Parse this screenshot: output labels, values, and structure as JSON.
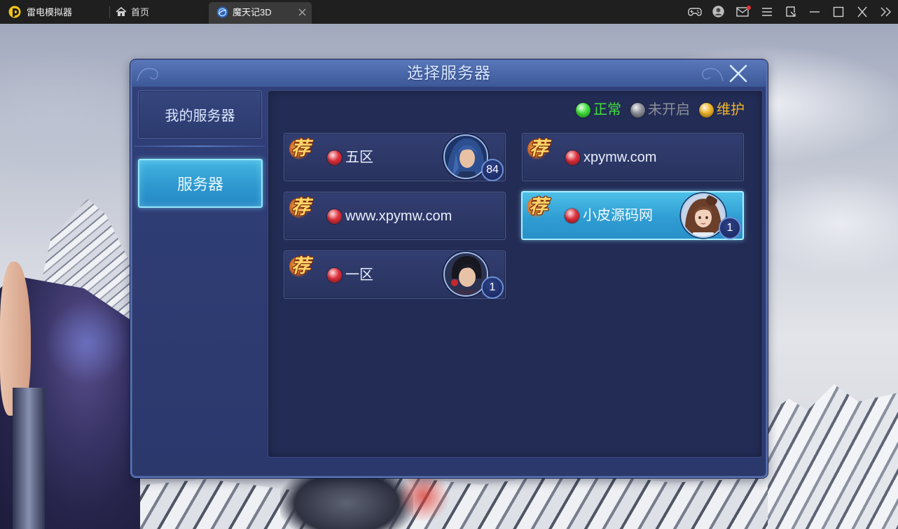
{
  "emulator": {
    "app_name": "雷电模拟器",
    "home_tab": "首页",
    "active_tab": "魔天记3D",
    "icons": [
      "logo-icon",
      "home-icon",
      "game-icon",
      "tab-close-icon",
      "gamepad-icon",
      "user-icon",
      "mail-icon",
      "menu-icon",
      "expand-icon",
      "minimize-icon",
      "maximize-icon",
      "close-icon",
      "more-icon"
    ],
    "notification_dot_color": "#e8302f"
  },
  "dialog": {
    "title": "选择服务器",
    "close_icon": "close-icon",
    "sidebar": [
      {
        "label": "我的服务器",
        "selected": false
      },
      {
        "label": "服务器",
        "selected": true
      }
    ],
    "legend": [
      {
        "label": "正常",
        "color": "#3fe03b"
      },
      {
        "label": "未开启",
        "color": "#8c9099"
      },
      {
        "label": "维护",
        "color": "#f0b52a"
      }
    ],
    "servers": [
      {
        "badge": "荐",
        "name": "五区",
        "status_color": "#e0303c",
        "player_count": "84",
        "avatar": "blue-haired-hero-portrait",
        "selected": false
      },
      {
        "badge": "荐",
        "name": "xpymw.com",
        "status_color": "#e0303c",
        "selected": false
      },
      {
        "badge": "荐",
        "name": "www.xpymw.com",
        "status_color": "#e0303c",
        "selected": false
      },
      {
        "badge": "荐",
        "name": "小皮源码网",
        "status_color": "#e0303c",
        "player_count": "1",
        "avatar": "heroine-portrait",
        "selected": true
      },
      {
        "badge": "荐",
        "name": "一区",
        "status_color": "#e0303c",
        "player_count": "1",
        "avatar": "dark-haired-hero-portrait",
        "selected": false
      }
    ]
  }
}
